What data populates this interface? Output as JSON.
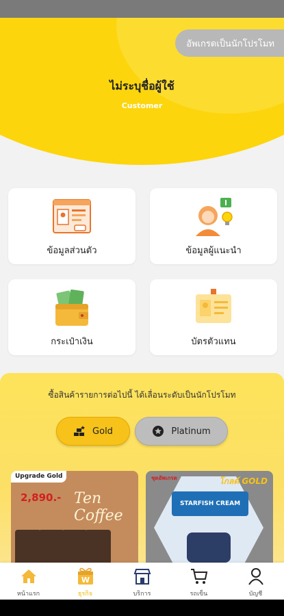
{
  "header": {
    "upgrade_label": "อัพเกรดเป็นนักโปรโมท",
    "user_name": "ไม่ระบุชื่อผู้ใช้",
    "user_role": "Customer"
  },
  "menu": {
    "items": [
      {
        "label": "ข้อมูลส่วนตัว",
        "icon": "profile-document-icon"
      },
      {
        "label": "ข้อมูลผู้แนะนำ",
        "icon": "referrer-person-icon"
      },
      {
        "label": "กระเป๋าเงิน",
        "icon": "wallet-icon"
      },
      {
        "label": "บัตรตัวแทน",
        "icon": "id-card-icon"
      }
    ]
  },
  "promo": {
    "headline": "ซื้อสินค้ารายการต่อไปนี้ ได้เลื่อนระดับเป็นนักโปรโมท",
    "tiers": [
      {
        "label": "Gold",
        "icon": "gold-bars-icon",
        "selected": true
      },
      {
        "label": "Platinum",
        "icon": "star-badge-icon",
        "selected": false
      }
    ],
    "products": [
      {
        "tag": "Upgrade Gold",
        "price": "2,890.-",
        "title": "Ten Coffee"
      },
      {
        "tag": "ชุดอัพเกรด",
        "badge": "โกลด์ GOLD",
        "title": "STARFISH CREAM"
      }
    ]
  },
  "bottom_nav": {
    "items": [
      {
        "label": "หน้าแรก",
        "icon": "home-icon",
        "active": false
      },
      {
        "label": "ธุรกิจ",
        "icon": "business-gift-icon",
        "active": true
      },
      {
        "label": "บริการ",
        "icon": "store-icon",
        "active": false
      },
      {
        "label": "รถเข็น",
        "icon": "cart-icon",
        "active": false
      },
      {
        "label": "บัญชี",
        "icon": "account-icon",
        "active": false
      }
    ]
  },
  "colors": {
    "brand_yellow": "#fcd50c",
    "gold_button": "#f7c21a",
    "platinum_button": "#bdbdbd",
    "nav_active": "#f0b800"
  }
}
